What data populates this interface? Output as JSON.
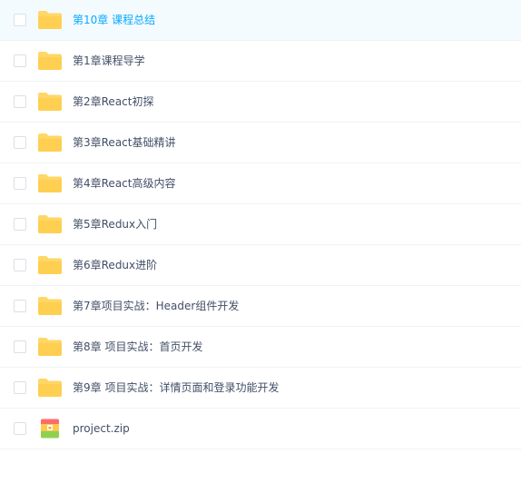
{
  "files": [
    {
      "name": "第10章 课程总结",
      "type": "folder",
      "state": "hover"
    },
    {
      "name": "第1章课程导学",
      "type": "folder"
    },
    {
      "name": "第2章React初探",
      "type": "folder"
    },
    {
      "name": "第3章React基础精讲",
      "type": "folder"
    },
    {
      "name": "第4章React高级内容",
      "type": "folder"
    },
    {
      "name": "第5章Redux入门",
      "type": "folder"
    },
    {
      "name": "第6章Redux进阶",
      "type": "folder"
    },
    {
      "name": "第7章项目实战：Header组件开发",
      "type": "folder"
    },
    {
      "name": "第8章 项目实战：首页开发",
      "type": "folder"
    },
    {
      "name": "第9章 项目实战：详情页面和登录功能开发",
      "type": "folder"
    },
    {
      "name": "project.zip",
      "type": "zip"
    }
  ],
  "icons": {
    "folder": "folder-icon",
    "zip": "zip-archive-icon"
  },
  "colors": {
    "hover_text": "#09aaff",
    "hover_bg": "#f4fbff",
    "folder": "#ffd766",
    "text": "#424e67"
  }
}
